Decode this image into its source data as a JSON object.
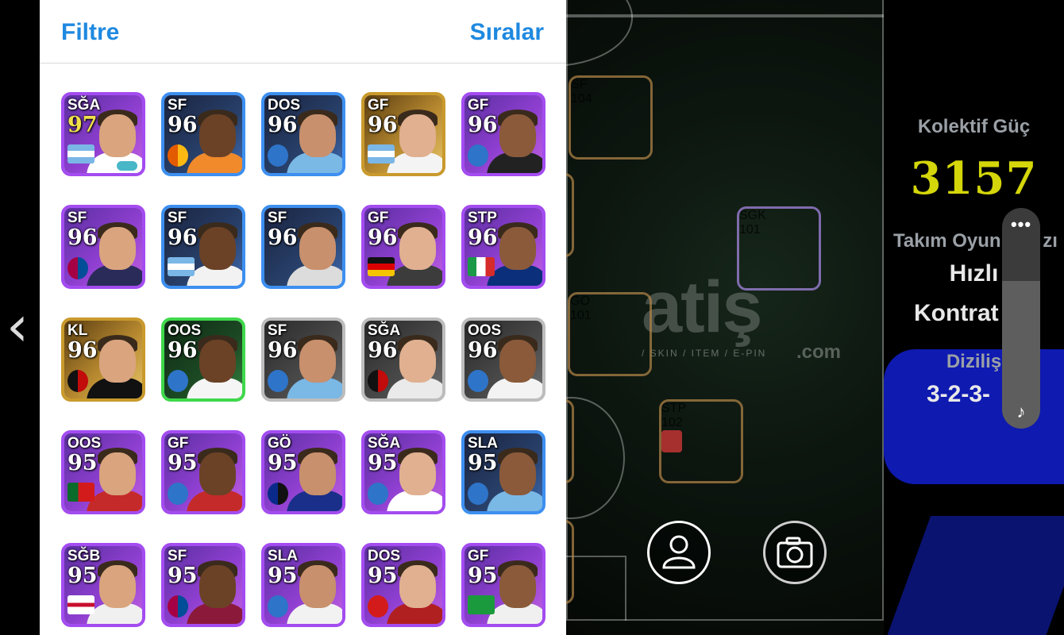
{
  "header": {
    "filter_label": "Filtre",
    "sort_label": "Sıralar"
  },
  "stats": {
    "collective_power_label": "Kolektif Güç",
    "collective_power_value": "3157",
    "team_style_label": "Takım Oyun",
    "team_style_label_tail": "zı",
    "team_style_value_1": "Hızlı",
    "team_style_value_2": "Kontrat",
    "formation_label": "Diziliş",
    "formation_value": "3-2-3-"
  },
  "watermark": {
    "main": "atiş",
    "sub": "/ SKIN / ITEM / E-PIN",
    "domain": ".com"
  },
  "volume": {
    "menu": "•••",
    "icon": "sound-icon",
    "level": 0.67
  },
  "buttons": {
    "player_icon": "person-icon",
    "camera_icon": "camera-icon"
  },
  "player_grid": [
    [
      {
        "pos": "SĞA",
        "rating": "97",
        "badge": "argentina-flag",
        "frame": "purple",
        "rating_color": "yellow"
      },
      {
        "pos": "SF",
        "rating": "96",
        "badge": "galatasaray-logo",
        "frame": "blue"
      },
      {
        "pos": "DOS",
        "rating": "96",
        "badge": "club-logo",
        "frame": "blue"
      },
      {
        "pos": "GF",
        "rating": "96",
        "badge": "argentina-flag",
        "frame": "gold"
      },
      {
        "pos": "GF",
        "rating": "96",
        "badge": "club-logo",
        "frame": "purple"
      }
    ],
    [
      {
        "pos": "SF",
        "rating": "96",
        "badge": "barcelona-logo",
        "frame": "purple"
      },
      {
        "pos": "SF",
        "rating": "96",
        "badge": "argentina-flag",
        "frame": "blue"
      },
      {
        "pos": "SF",
        "rating": "96",
        "badge": "",
        "frame": "blue"
      },
      {
        "pos": "GF",
        "rating": "96",
        "badge": "germany-flag",
        "frame": "purple"
      },
      {
        "pos": "STP",
        "rating": "96",
        "badge": "italy-flag",
        "frame": "purple"
      }
    ],
    [
      {
        "pos": "KL",
        "rating": "96",
        "badge": "milan-logo",
        "frame": "gold"
      },
      {
        "pos": "OOS",
        "rating": "96",
        "badge": "club-logo",
        "frame": "green"
      },
      {
        "pos": "SF",
        "rating": "96",
        "badge": "club-logo",
        "frame": "silver"
      },
      {
        "pos": "SĞA",
        "rating": "96",
        "badge": "milan-logo",
        "frame": "silver"
      },
      {
        "pos": "OOS",
        "rating": "96",
        "badge": "club-logo",
        "frame": "silver"
      }
    ],
    [
      {
        "pos": "OOS",
        "rating": "95",
        "badge": "portugal-flag",
        "frame": "purple"
      },
      {
        "pos": "GF",
        "rating": "95",
        "badge": "club-logo",
        "frame": "purple"
      },
      {
        "pos": "GÖ",
        "rating": "95",
        "badge": "inter-logo",
        "frame": "purple"
      },
      {
        "pos": "SĞA",
        "rating": "95",
        "badge": "club-logo",
        "frame": "purple"
      },
      {
        "pos": "SLA",
        "rating": "95",
        "badge": "club-logo",
        "frame": "blue"
      }
    ],
    [
      {
        "pos": "SĞB",
        "rating": "95",
        "badge": "england-flag",
        "frame": "purple"
      },
      {
        "pos": "SF",
        "rating": "95",
        "badge": "barcelona-logo",
        "frame": "purple"
      },
      {
        "pos": "SLA",
        "rating": "95",
        "badge": "club-logo",
        "frame": "purple"
      },
      {
        "pos": "DOS",
        "rating": "95",
        "badge": "manutd-logo",
        "frame": "purple"
      },
      {
        "pos": "GF",
        "rating": "95",
        "badge": "brazil-flag",
        "frame": "purple"
      }
    ]
  ],
  "pitch_players": [
    {
      "pos": "SF",
      "rating": "104",
      "frame": "gold"
    },
    {
      "pos": "SGK",
      "rating": "101",
      "frame": "purple"
    },
    {
      "pos": "GÖ",
      "rating": "101",
      "frame": "gold"
    },
    {
      "pos": "STP",
      "rating": "102",
      "frame": "gold"
    }
  ],
  "colors": {
    "accent": "#1f89e0",
    "power": "#d4d60a",
    "formation_block": "#0e1ab0"
  }
}
